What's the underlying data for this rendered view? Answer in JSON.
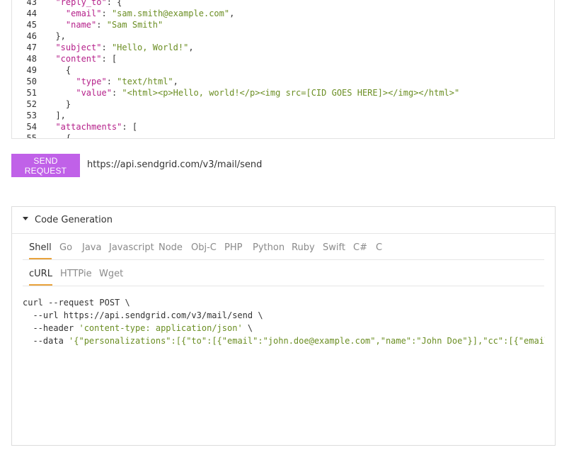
{
  "editor": {
    "lines": [
      {
        "n": "43",
        "parts": [
          [
            "t",
            "  "
          ],
          [
            "k",
            "\"reply_to\""
          ],
          [
            "p",
            ": {"
          ]
        ]
      },
      {
        "n": "44",
        "parts": [
          [
            "t",
            "    "
          ],
          [
            "k",
            "\"email\""
          ],
          [
            "p",
            ": "
          ],
          [
            "s",
            "\"sam.smith@example.com\""
          ],
          [
            "p",
            ","
          ]
        ]
      },
      {
        "n": "45",
        "parts": [
          [
            "t",
            "    "
          ],
          [
            "k",
            "\"name\""
          ],
          [
            "p",
            ": "
          ],
          [
            "s",
            "\"Sam Smith\""
          ]
        ]
      },
      {
        "n": "46",
        "parts": [
          [
            "t",
            "  "
          ],
          [
            "p",
            "},"
          ]
        ]
      },
      {
        "n": "47",
        "parts": [
          [
            "t",
            "  "
          ],
          [
            "k",
            "\"subject\""
          ],
          [
            "p",
            ": "
          ],
          [
            "s",
            "\"Hello, World!\""
          ],
          [
            "p",
            ","
          ]
        ]
      },
      {
        "n": "48",
        "parts": [
          [
            "t",
            "  "
          ],
          [
            "k",
            "\"content\""
          ],
          [
            "p",
            ": ["
          ]
        ]
      },
      {
        "n": "49",
        "parts": [
          [
            "t",
            "    "
          ],
          [
            "p",
            "{"
          ]
        ]
      },
      {
        "n": "50",
        "parts": [
          [
            "t",
            "      "
          ],
          [
            "k",
            "\"type\""
          ],
          [
            "p",
            ": "
          ],
          [
            "s",
            "\"text/html\""
          ],
          [
            "p",
            ","
          ]
        ]
      },
      {
        "n": "51",
        "parts": [
          [
            "t",
            "      "
          ],
          [
            "k",
            "\"value\""
          ],
          [
            "p",
            ": "
          ],
          [
            "s",
            "\"<html><p>Hello, world!</p><img src=[CID GOES HERE]></img></html>\""
          ]
        ]
      },
      {
        "n": "52",
        "parts": [
          [
            "t",
            "    "
          ],
          [
            "p",
            "}"
          ]
        ]
      },
      {
        "n": "53",
        "parts": [
          [
            "t",
            "  "
          ],
          [
            "p",
            "],"
          ]
        ]
      },
      {
        "n": "54",
        "parts": [
          [
            "t",
            "  "
          ],
          [
            "k",
            "\"attachments\""
          ],
          [
            "p",
            ": ["
          ]
        ]
      },
      {
        "n": "55",
        "parts": [
          [
            "t",
            "    "
          ],
          [
            "p",
            "{"
          ]
        ]
      }
    ]
  },
  "request": {
    "send_label": "SEND REQUEST",
    "url": "https://api.sendgrid.com/v3/mail/send"
  },
  "codegen": {
    "title": "Code Generation",
    "languages": [
      "Shell",
      "Go",
      "Java",
      "Javascript",
      "Node",
      "Obj-C",
      "PHP",
      "Python",
      "Ruby",
      "Swift",
      "C#",
      "C"
    ],
    "active_language": "Shell",
    "clients": [
      "cURL",
      "HTTPie",
      "Wget"
    ],
    "active_client": "cURL",
    "snippet": {
      "line1": "curl --request POST \\",
      "line2": "  --url https://api.sendgrid.com/v3/mail/send \\",
      "line3_prefix": "  --header ",
      "line3_str": "'content-type: application/json'",
      "line3_suffix": " \\",
      "line4_prefix": "  --data ",
      "line4_str": "'{\"personalizations\":[{\"to\":[{\"email\":\"john.doe@example.com\",\"name\":\"John Doe\"}],\"cc\":[{\"email\":\"jane.doe@example.com\""
    }
  },
  "colors": {
    "accent": "#c061e8",
    "tab_underline": "#e9a23b",
    "json_key": "#b5208a",
    "json_string": "#6b8e23"
  }
}
